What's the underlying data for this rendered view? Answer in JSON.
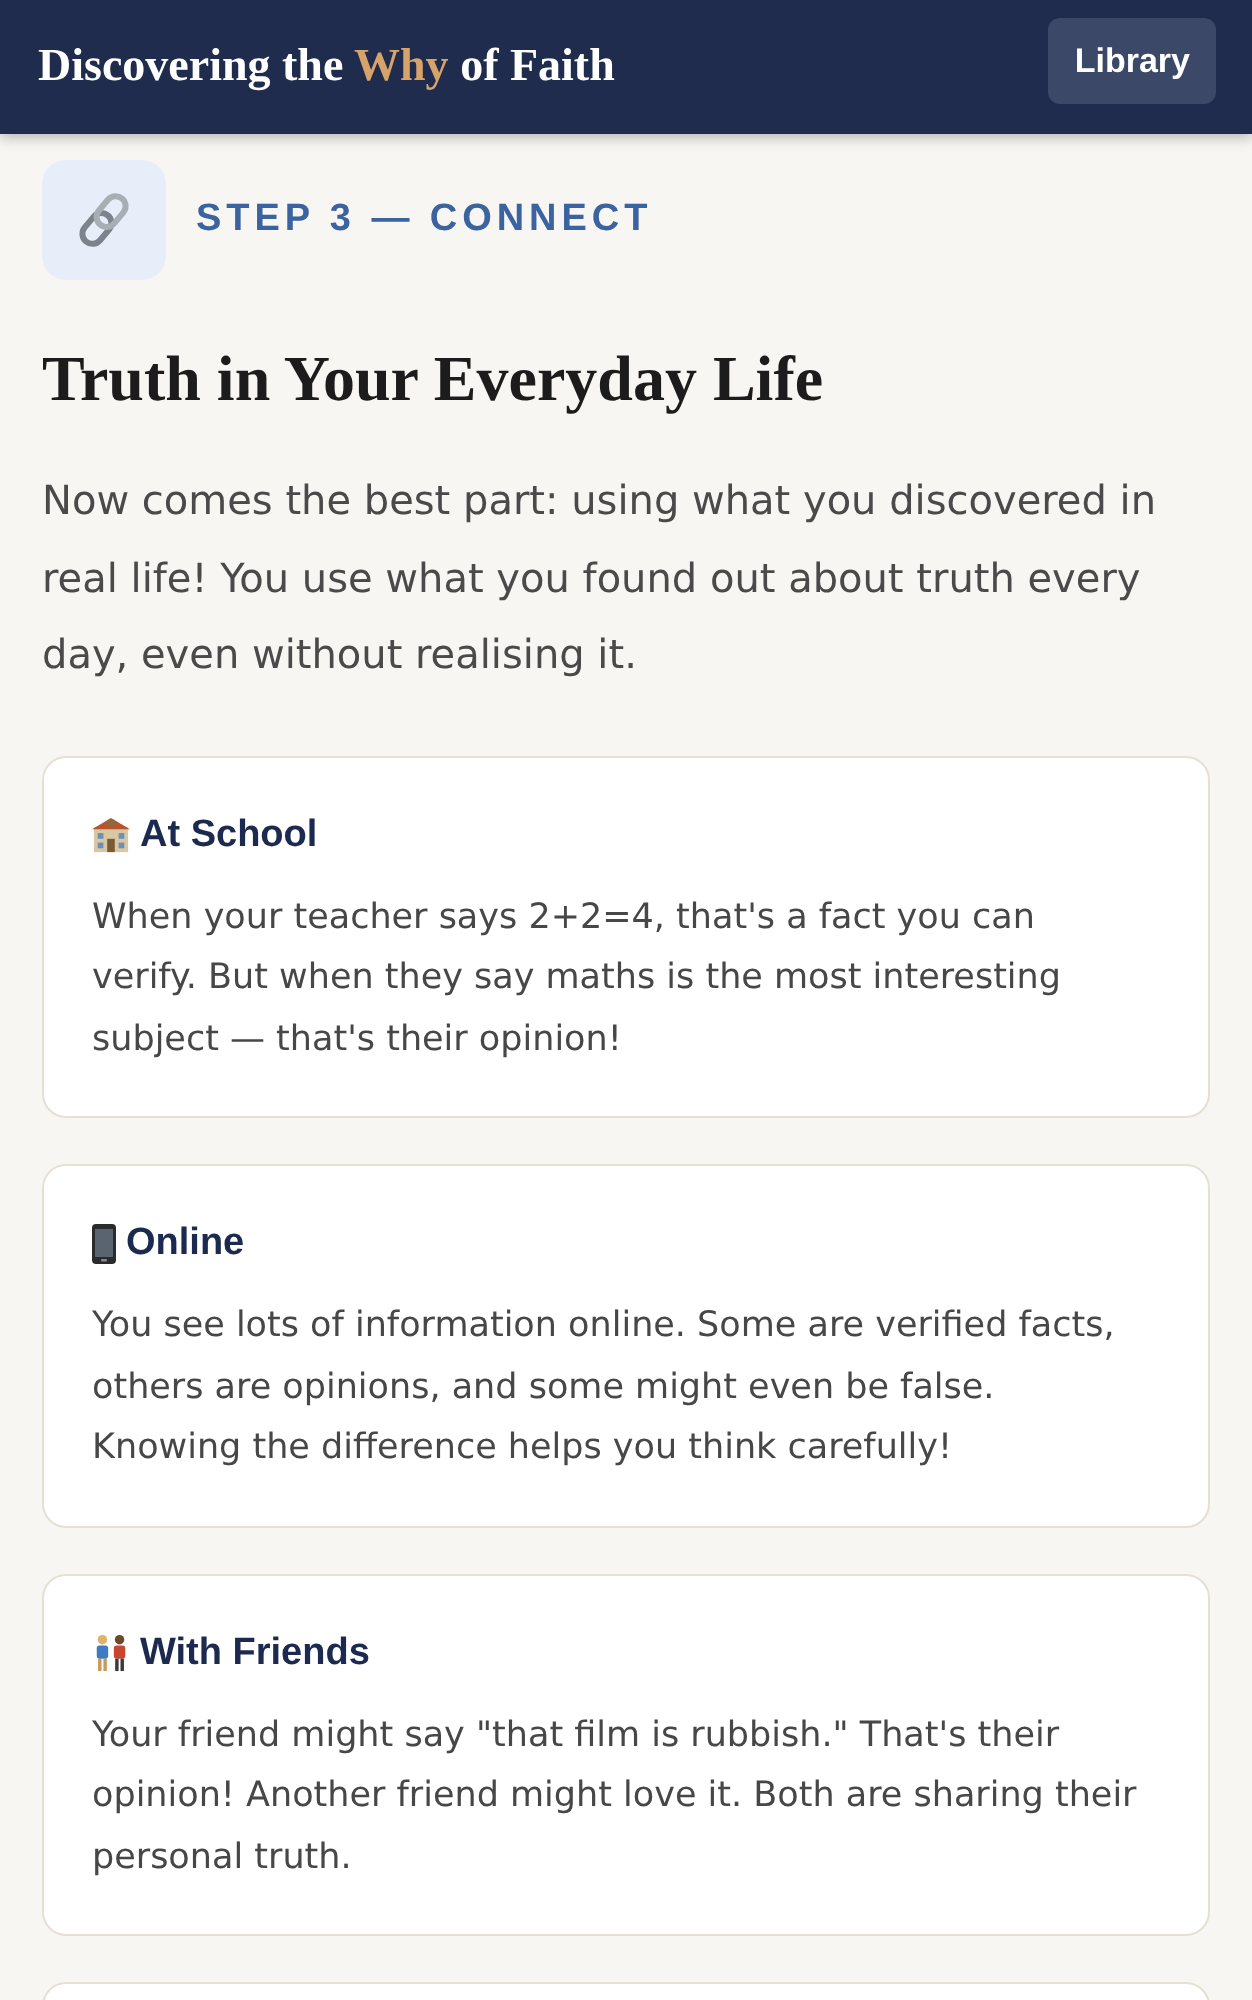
{
  "header": {
    "title": [
      {
        "text": "Discovering the",
        "highlight": false
      },
      {
        "text": "Why",
        "highlight": true
      },
      {
        "text": "of Faith",
        "highlight": false
      }
    ],
    "button": "Library"
  },
  "step": {
    "kind": "link",
    "label": "STEP 3 — CONNECT"
  },
  "heading": "Truth in Your Everyday Life",
  "intro": "Now comes the best part: using what you discovered in real life! You use what you found out about truth every day, even without realising it.",
  "cards": [
    {
      "kind": "school",
      "title": "At School",
      "text": "When your teacher says 2+2=4, that's a fact you can verify. But when they say maths is the most interesting subject — that's their opinion!"
    },
    {
      "kind": "phone",
      "title": "Online",
      "text": "You see lots of information online. Some are verified facts, others are opinions, and some might even be false. Knowing the difference helps you think carefully!"
    },
    {
      "kind": "friends",
      "title": "With Friends",
      "text": "Your friend might say \"that film is rubbish.\" That's their opinion! Another friend might love it. Both are sharing their personal truth."
    }
  ],
  "more_below": true
}
